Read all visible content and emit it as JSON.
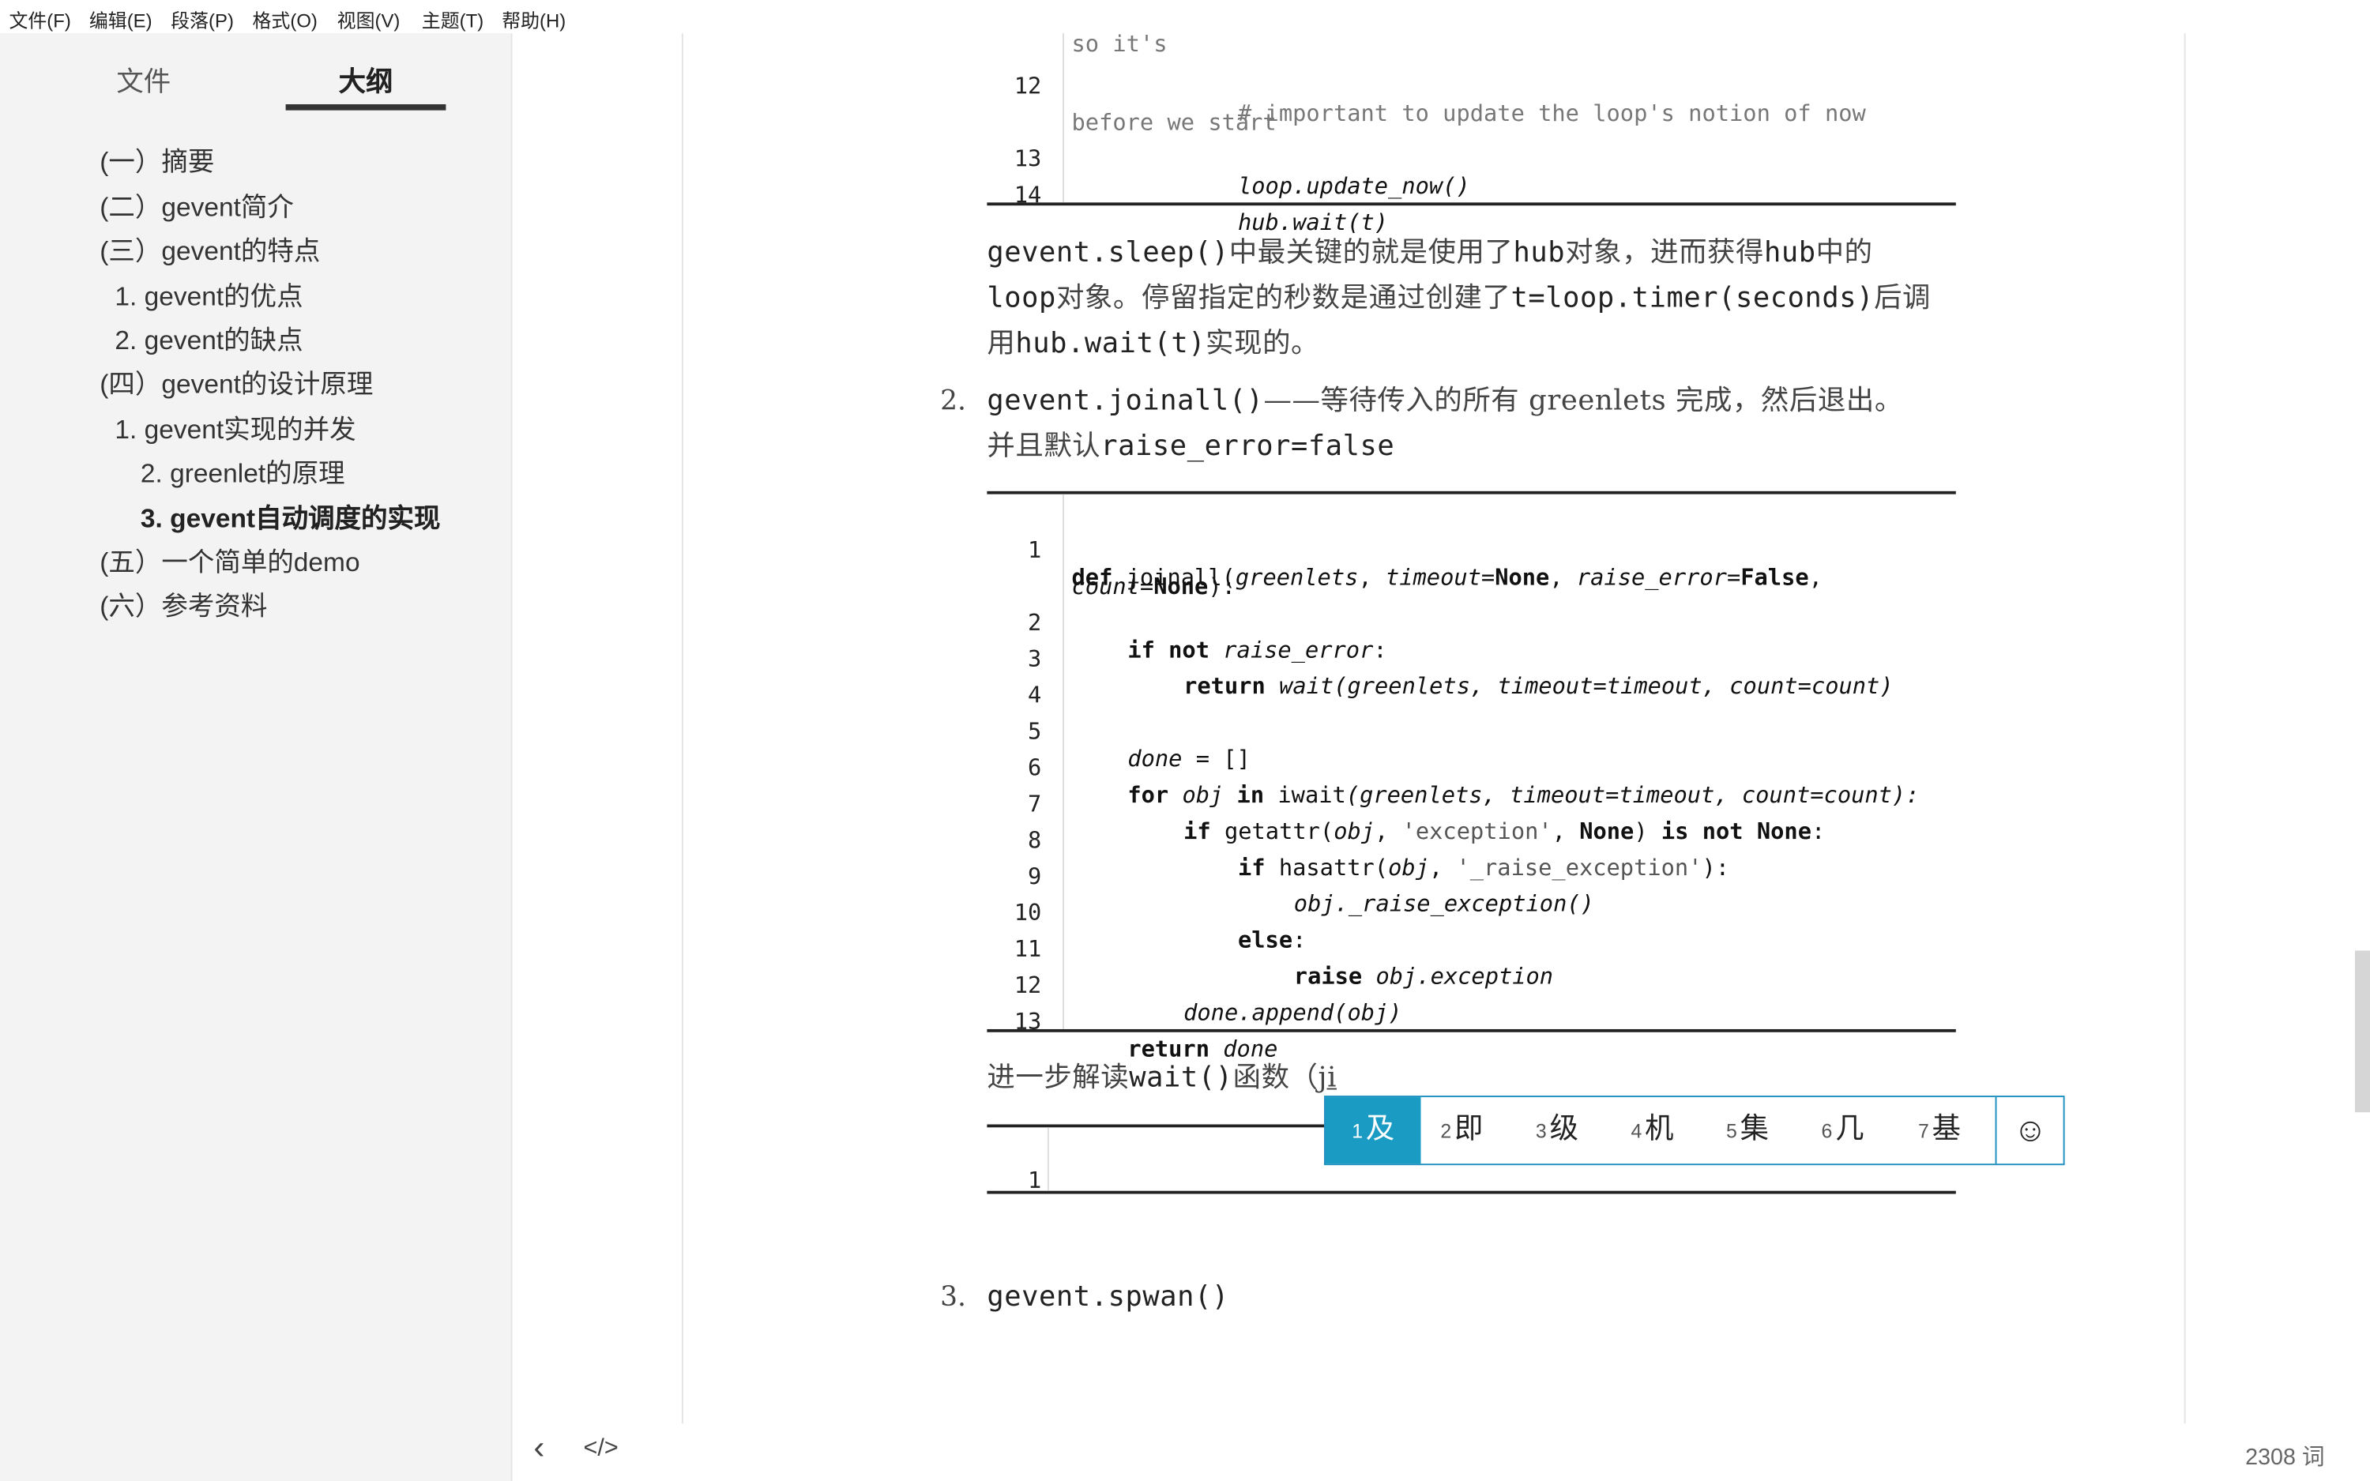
{
  "menubar": [
    "文件(F)",
    "编辑(E)",
    "段落(P)",
    "格式(O)",
    "视图(V)",
    "主题(T)",
    "帮助(H)"
  ],
  "sidebar": {
    "tabs": [
      "文件",
      "大纲"
    ],
    "outline": [
      "(一）摘要",
      "(二）gevent简介",
      "(三）gevent的特点",
      "1. gevent的优点",
      "2. gevent的缺点",
      "(四）gevent的设计原理",
      "1. gevent实现的并发",
      "2. greenlet的原理",
      "3. gevent自动调度的实现",
      "(五）一个简单的demo",
      "(六）参考资料"
    ]
  },
  "editor": {
    "top_code": {
      "partial_line": "so it's",
      "line12_num": "12",
      "line12_comment": "# important to update the loop's notion of now",
      "line12_wrap": "before we start",
      "line13_num": "13",
      "line13_code": "loop.update_now()",
      "line14_num": "14",
      "line14_code": "hub.wait(t)"
    },
    "para1": {
      "line1_code1": "gevent.sleep()",
      "line1_text1": "中最关键的就是使用了",
      "line1_code2": "hub",
      "line1_text2": "对象，进而获得",
      "line1_code3": "hub",
      "line1_text3": "中的",
      "line2_code1": "loop",
      "line2_text1": "对象。停留指定的秒数是通过创建了",
      "line2_code2": "t=loop.timer(seconds)",
      "line2_text2": "后调",
      "line3_text1": "用",
      "line3_code1": "hub.wait(t)",
      "line3_text2": "实现的。"
    },
    "item2": {
      "num": "2.",
      "code1": "gevent.joinall()",
      "text1": "——等待传入的所有 greenlets 完成，然后退出。",
      "text2": "并且默认",
      "code2": "raise_error=false"
    },
    "joinall_code": {
      "nums": [
        "1",
        "2",
        "3",
        "4",
        "5",
        "6",
        "7",
        "8",
        "9",
        "10",
        "11",
        "12",
        "13"
      ],
      "l1a_kw": "def",
      "l1a_name": " joinall(",
      "l1a_p1": "greenlets",
      "l1a_c1": ", ",
      "l1a_p2": "timeout",
      "l1a_eq1": "=",
      "l1a_none1": "None",
      "l1a_c2": ", ",
      "l1a_p3": "raise_error",
      "l1a_eq2": "=",
      "l1a_false": "False",
      "l1a_c3": ",",
      "l1b_p": "count",
      "l1b_eq": "=",
      "l1b_none": "None",
      "l1b_end": "):",
      "l2_kw": "if not",
      "l2_var": " raise_error",
      "l2_end": ":",
      "l3_kw": "return",
      "l3_fn": " wait",
      "l3_args": "(greenlets, timeout=timeout, count=count)",
      "l5_var": "done",
      "l5_rest": " = []",
      "l6_kw1": "for",
      "l6_var": " obj ",
      "l6_kw2": "in",
      "l6_fn": " iwait",
      "l6_args": "(greenlets, timeout=timeout, count=count):",
      "l7_kw": "if",
      "l7_a": " getattr(",
      "l7_obj": "obj",
      "l7_b": ", ",
      "l7_str": "'exception'",
      "l7_c": ", ",
      "l7_none": "None",
      "l7_d": ") ",
      "l7_kw2": "is not",
      "l7_e": " ",
      "l7_none2": "None",
      "l7_f": ":",
      "l8_kw": "if",
      "l8_a": " hasattr(",
      "l8_obj": "obj",
      "l8_b": ", ",
      "l8_str": "'_raise_exception'",
      "l8_c": "):",
      "l9_code": "obj._raise_exception()",
      "l10_kw": "else",
      "l10_end": ":",
      "l11_kw": "raise",
      "l11_obj": " obj.exception",
      "l12_code": "done.append(obj)",
      "l13_kw": "return",
      "l13_var": " done"
    },
    "para2": {
      "text1": "进一步解读",
      "code1": "wait()",
      "text2": "函数（",
      "composing": "ji"
    },
    "empty_code": {
      "num": "1"
    },
    "item3": {
      "num": "3.",
      "code": "gevent.spwan()"
    }
  },
  "ime": {
    "candidates": [
      {
        "n": "1",
        "c": "及"
      },
      {
        "n": "2",
        "c": "即"
      },
      {
        "n": "3",
        "c": "级"
      },
      {
        "n": "4",
        "c": "机"
      },
      {
        "n": "5",
        "c": "集"
      },
      {
        "n": "6",
        "c": "几"
      },
      {
        "n": "7",
        "c": "基"
      }
    ],
    "emoji": "☺"
  },
  "statusbar": {
    "back": "‹",
    "source": "</>",
    "wordcount": "2308 词"
  }
}
